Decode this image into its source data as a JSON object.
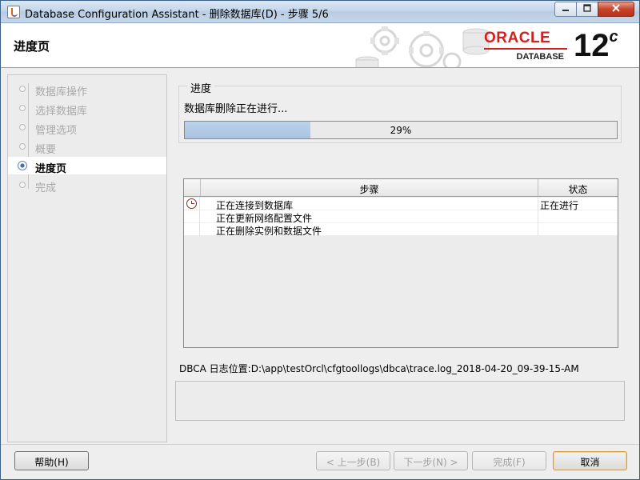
{
  "window": {
    "title": "Database Configuration Assistant - 删除数据库(D) - 步骤 5/6",
    "controls": {
      "minimize": "▭",
      "maximize": "☐",
      "close": "✕"
    }
  },
  "header": {
    "page_title": "进度页",
    "brand_name": "ORACLE",
    "brand_product": "DATABASE",
    "version_number": "12",
    "version_suffix": "c"
  },
  "sidebar": {
    "steps": [
      {
        "label": "数据库操作",
        "state": "done"
      },
      {
        "label": "选择数据库",
        "state": "done"
      },
      {
        "label": "管理选项",
        "state": "done"
      },
      {
        "label": "概要",
        "state": "done"
      },
      {
        "label": "进度页",
        "state": "active"
      },
      {
        "label": "完成",
        "state": "pending"
      }
    ]
  },
  "progress": {
    "legend": "进度",
    "message": "数据库删除正在进行...",
    "percent": 29,
    "percent_label": "29%"
  },
  "steps_table": {
    "columns": [
      "步骤",
      "状态"
    ],
    "rows": [
      {
        "step": "正在连接到数据库",
        "status": "正在进行",
        "icon": "clock-icon"
      },
      {
        "step": "正在更新网络配置文件",
        "status": "",
        "icon": ""
      },
      {
        "step": "正在删除实例和数据文件",
        "status": "",
        "icon": ""
      }
    ]
  },
  "log": {
    "text": "DBCA 日志位置:D:\\app\\testOrcl\\cfgtoollogs\\dbca\\trace.log_2018-04-20_09-39-15-AM"
  },
  "buttons": {
    "help": "帮助(H)",
    "back": "< 上一步(B)",
    "next": "下一步(N) >",
    "finish": "完成(F)",
    "cancel": "取消"
  },
  "colors": {
    "oracle_red": "#d2211f",
    "progress_fill": "#a9c3e0",
    "active_step_dot": "#3f73b5"
  }
}
